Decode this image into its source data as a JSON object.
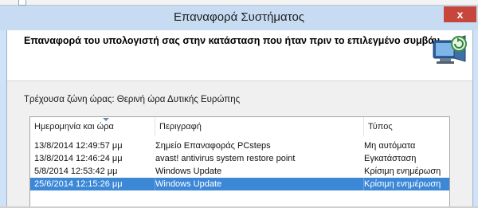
{
  "window": {
    "title": "Επαναφορά Συστήματος",
    "close_glyph": "x",
    "heading": "Επαναφορά του υπολογιστή σας στην κατάσταση που ήταν πριν το επιλεγμένο συμβάν",
    "header_icon": "system-restore-icon"
  },
  "timezone_text": "Τρέχουσα ζώνη ώρας: Θερινή ώρα Δυτικής Ευρώπης",
  "table": {
    "columns": [
      "Ημερομηνία και ώρα",
      "Περιγραφή",
      "Τύπος"
    ],
    "rows": [
      {
        "datetime": "13/8/2014 12:49:57 μμ",
        "description": "Σημείο Επαναφοράς PCsteps",
        "type": "Μη αυτόματα",
        "selected": false
      },
      {
        "datetime": "13/8/2014 12:46:24 μμ",
        "description": "avast! antivirus system restore point",
        "type": "Εγκατάσταση",
        "selected": false
      },
      {
        "datetime": "5/8/2014 12:53:42 μμ",
        "description": "Windows Update",
        "type": "Κρίσιμη ενημέρωση",
        "selected": false
      },
      {
        "datetime": "25/6/2014 12:15:26 μμ",
        "description": "Windows Update",
        "type": "Κρίσιμη ενημέρωση",
        "selected": true
      }
    ]
  },
  "colors": {
    "selection": "#3c87d6",
    "titlebar": "#c7dcf2",
    "close_button": "#c7463c"
  }
}
